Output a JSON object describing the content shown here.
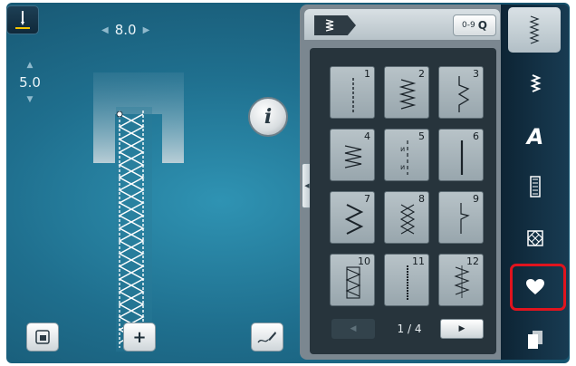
{
  "stitch_settings": {
    "width_value": "8.0",
    "length_value": "5.0"
  },
  "panel": {
    "search_label": "0-9",
    "pager": {
      "text": "1 / 4"
    },
    "cells": [
      {
        "num": "1"
      },
      {
        "num": "2"
      },
      {
        "num": "3"
      },
      {
        "num": "4"
      },
      {
        "num": "5"
      },
      {
        "num": "6"
      },
      {
        "num": "7"
      },
      {
        "num": "8"
      },
      {
        "num": "9"
      },
      {
        "num": "10"
      },
      {
        "num": "11"
      },
      {
        "num": "12"
      }
    ]
  },
  "sidebar": {
    "alphabet_label": "A"
  },
  "colors": {
    "highlight": "#e0141e",
    "screen": "#1f6f8e"
  }
}
